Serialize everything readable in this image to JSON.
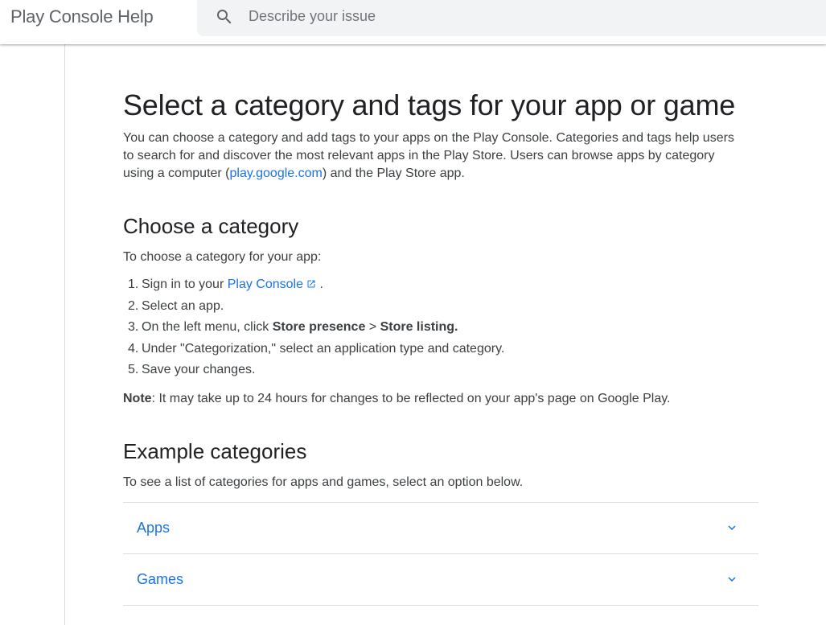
{
  "header": {
    "brand": "Play Console Help",
    "search": {
      "placeholder": "Describe your issue",
      "value": ""
    }
  },
  "article": {
    "title": "Select a category and tags for your app or game",
    "intro_before_link": "You can choose a category and add tags to your apps on the Play Console. Categories and tags help users to search for and discover the most relevant apps in the Play Store. Users can browse apps by category using a computer (",
    "intro_link": "play.google.com",
    "intro_after_link": ") and the Play Store app.",
    "section1": {
      "heading": "Choose a category",
      "lead": "To choose a category for your app:",
      "steps": [
        {
          "num": "1.",
          "text_before": "Sign in to your ",
          "link": "Play Console",
          "text_after": " ."
        },
        {
          "num": "2.",
          "text": "Select an app."
        },
        {
          "num": "3.",
          "text_before": "On the left menu, click ",
          "bold1": "Store presence",
          "mid": " > ",
          "bold2": "Store listing."
        },
        {
          "num": "4.",
          "text": "Under \"Categorization,\" select an application type and category."
        },
        {
          "num": "5.",
          "text": "Save your changes."
        }
      ],
      "note_label": "Note",
      "note_text": ": It may take up to 24 hours for changes to be reflected on your app's page on Google Play."
    },
    "section2": {
      "heading": "Example categories",
      "lead": "To see a list of categories for apps and games, select an option below.",
      "accordion": [
        {
          "label": "Apps",
          "icon": "chevron-down-icon"
        },
        {
          "label": "Games",
          "icon": "chevron-down-icon"
        }
      ]
    }
  },
  "colors": {
    "link": "#1a73e8",
    "text": "#3c4043",
    "heading": "#202124",
    "search_bg": "#f1f3f4",
    "divider": "#dadce0"
  }
}
